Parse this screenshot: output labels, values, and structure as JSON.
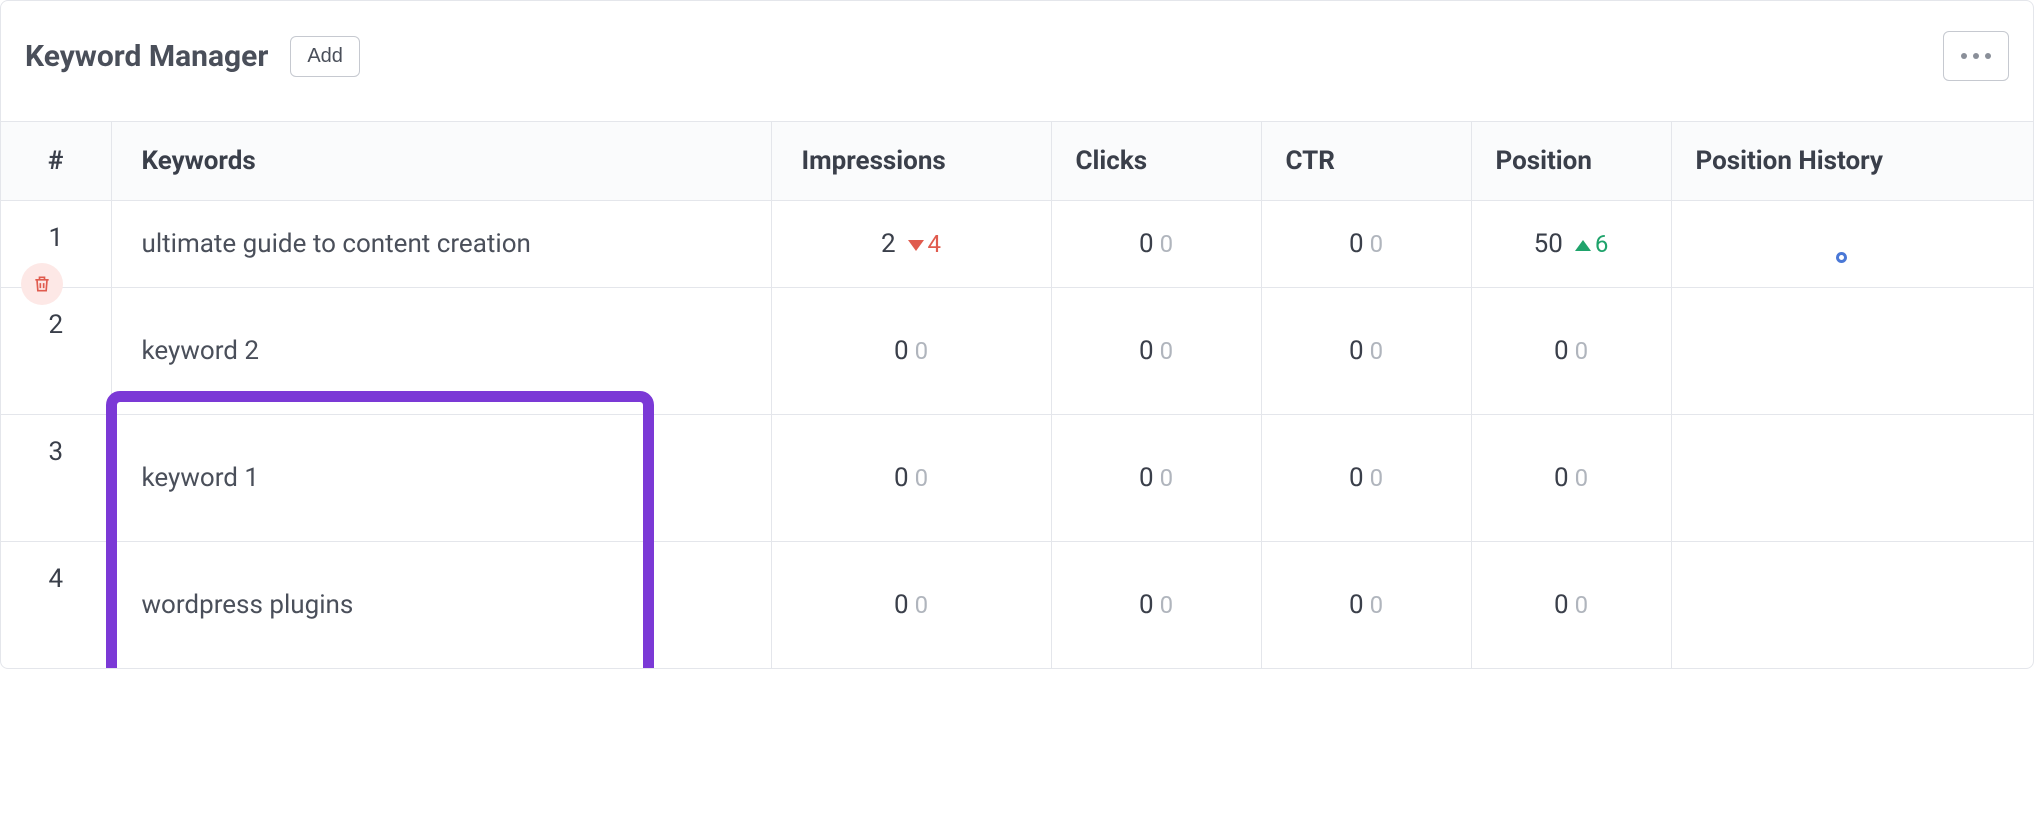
{
  "header": {
    "title": "Keyword Manager",
    "add_label": "Add"
  },
  "columns": {
    "num": "#",
    "keywords": "Keywords",
    "impressions": "Impressions",
    "clicks": "Clicks",
    "ctr": "CTR",
    "position": "Position",
    "position_history": "Position History"
  },
  "rows": [
    {
      "num": "1",
      "keyword": "ultimate guide to content creation",
      "impressions": "2",
      "impressions_delta": "4",
      "impressions_dir": "down",
      "clicks": "0",
      "clicks_sub": "0",
      "ctr": "0",
      "ctr_sub": "0",
      "position": "50",
      "position_delta": "6",
      "position_dir": "up",
      "has_trash": true,
      "has_history_dot": true
    },
    {
      "num": "2",
      "keyword": "keyword 2",
      "impressions": "0",
      "impressions_sub": "0",
      "clicks": "0",
      "clicks_sub": "0",
      "ctr": "0",
      "ctr_sub": "0",
      "position": "0",
      "position_sub": "0"
    },
    {
      "num": "3",
      "keyword": "keyword 1",
      "impressions": "0",
      "impressions_sub": "0",
      "clicks": "0",
      "clicks_sub": "0",
      "ctr": "0",
      "ctr_sub": "0",
      "position": "0",
      "position_sub": "0"
    },
    {
      "num": "4",
      "keyword": "wordpress plugins",
      "impressions": "0",
      "impressions_sub": "0",
      "clicks": "0",
      "clicks_sub": "0",
      "ctr": "0",
      "ctr_sub": "0",
      "position": "0",
      "position_sub": "0"
    }
  ]
}
